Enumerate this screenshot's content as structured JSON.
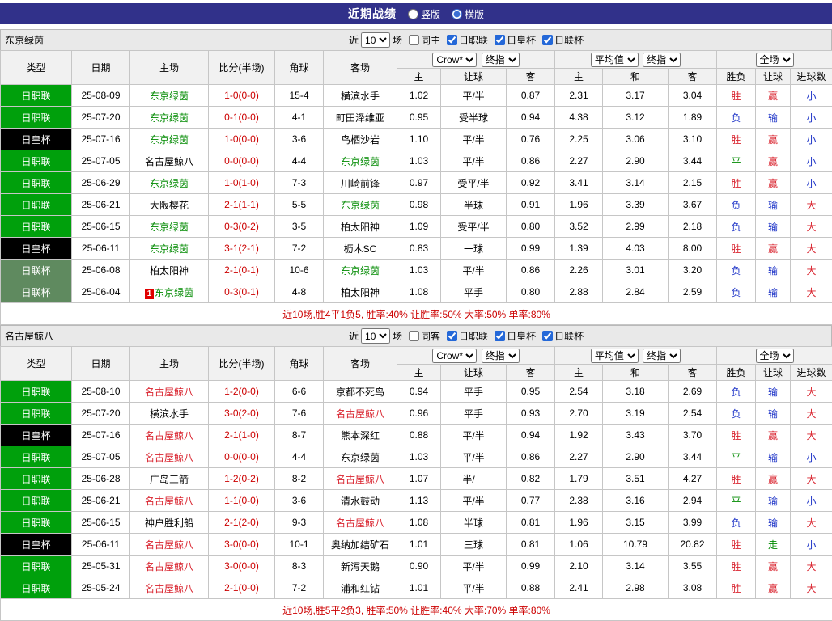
{
  "topbar": {
    "title": "近期战绩",
    "radios": [
      {
        "label": "竖版",
        "selected": false
      },
      {
        "label": "横版",
        "selected": true
      }
    ]
  },
  "filter": {
    "near": "近",
    "count": "10",
    "games": "场"
  },
  "table_header": {
    "cols": [
      "类型",
      "日期",
      "主场",
      "比分(半场)",
      "角球",
      "客场"
    ],
    "book_select": "Crow*",
    "final_select": "终指",
    "avg_select": "平均值",
    "scope_select": "全场",
    "odds_subs": [
      "主",
      "让球",
      "客"
    ],
    "avg_subs": [
      "主",
      "和",
      "客"
    ],
    "result_subs": [
      "胜负",
      "让球",
      "进球数"
    ]
  },
  "sections": [
    {
      "team": "东京绿茵",
      "checkboxes": [
        {
          "label": "同主",
          "checked": false
        },
        {
          "label": "日职联",
          "checked": true
        },
        {
          "label": "日皇杯",
          "checked": true
        },
        {
          "label": "日联杯",
          "checked": true
        }
      ],
      "rows": [
        {
          "league": "日职联",
          "lg": "jl",
          "date": "25-08-09",
          "home": "东京绿茵",
          "hc": "g",
          "badge": "",
          "score": "1-0(0-0)",
          "corner": "15-4",
          "away": "横滨水手",
          "ac": "k",
          "o1": "1.02",
          "hcap": "平/半",
          "o2": "0.87",
          "m1": "2.31",
          "m2": "3.17",
          "m3": "3.04",
          "r1": "胜",
          "r1c": "r",
          "r2": "赢",
          "r2c": "r",
          "r3": "小",
          "r3c": "b"
        },
        {
          "league": "日职联",
          "lg": "jl",
          "date": "25-07-20",
          "home": "东京绿茵",
          "hc": "g",
          "badge": "",
          "score": "0-1(0-0)",
          "corner": "4-1",
          "away": "町田泽维亚",
          "ac": "k",
          "o1": "0.95",
          "hcap": "受半球",
          "o2": "0.94",
          "m1": "4.38",
          "m2": "3.12",
          "m3": "1.89",
          "r1": "负",
          "r1c": "b",
          "r2": "输",
          "r2c": "b",
          "r3": "小",
          "r3c": "b"
        },
        {
          "league": "日皇杯",
          "lg": "hg",
          "date": "25-07-16",
          "home": "东京绿茵",
          "hc": "g",
          "badge": "",
          "score": "1-0(0-0)",
          "corner": "3-6",
          "away": "鸟栖沙岩",
          "ac": "k",
          "o1": "1.10",
          "hcap": "平/半",
          "o2": "0.76",
          "m1": "2.25",
          "m2": "3.06",
          "m3": "3.10",
          "r1": "胜",
          "r1c": "r",
          "r2": "赢",
          "r2c": "r",
          "r3": "小",
          "r3c": "b"
        },
        {
          "league": "日职联",
          "lg": "jl",
          "date": "25-07-05",
          "home": "名古屋鲸八",
          "hc": "k",
          "badge": "",
          "score": "0-0(0-0)",
          "corner": "4-4",
          "away": "东京绿茵",
          "ac": "g",
          "o1": "1.03",
          "hcap": "平/半",
          "o2": "0.86",
          "m1": "2.27",
          "m2": "2.90",
          "m3": "3.44",
          "r1": "平",
          "r1c": "g",
          "r2": "赢",
          "r2c": "r",
          "r3": "小",
          "r3c": "b"
        },
        {
          "league": "日职联",
          "lg": "jl",
          "date": "25-06-29",
          "home": "东京绿茵",
          "hc": "g",
          "badge": "",
          "score": "1-0(1-0)",
          "corner": "7-3",
          "away": "川崎前锋",
          "ac": "k",
          "o1": "0.97",
          "hcap": "受平/半",
          "o2": "0.92",
          "m1": "3.41",
          "m2": "3.14",
          "m3": "2.15",
          "r1": "胜",
          "r1c": "r",
          "r2": "赢",
          "r2c": "r",
          "r3": "小",
          "r3c": "b"
        },
        {
          "league": "日职联",
          "lg": "jl",
          "date": "25-06-21",
          "home": "大阪樱花",
          "hc": "k",
          "badge": "",
          "score": "2-1(1-1)",
          "corner": "5-5",
          "away": "东京绿茵",
          "ac": "g",
          "o1": "0.98",
          "hcap": "半球",
          "o2": "0.91",
          "m1": "1.96",
          "m2": "3.39",
          "m3": "3.67",
          "r1": "负",
          "r1c": "b",
          "r2": "输",
          "r2c": "b",
          "r3": "大",
          "r3c": "r"
        },
        {
          "league": "日职联",
          "lg": "jl",
          "date": "25-06-15",
          "home": "东京绿茵",
          "hc": "g",
          "badge": "",
          "score": "0-3(0-2)",
          "corner": "3-5",
          "away": "柏太阳神",
          "ac": "k",
          "o1": "1.09",
          "hcap": "受平/半",
          "o2": "0.80",
          "m1": "3.52",
          "m2": "2.99",
          "m3": "2.18",
          "r1": "负",
          "r1c": "b",
          "r2": "输",
          "r2c": "b",
          "r3": "大",
          "r3c": "r"
        },
        {
          "league": "日皇杯",
          "lg": "hg",
          "date": "25-06-11",
          "home": "东京绿茵",
          "hc": "g",
          "badge": "",
          "score": "3-1(2-1)",
          "corner": "7-2",
          "away": "枥木SC",
          "ac": "k",
          "o1": "0.83",
          "hcap": "一球",
          "o2": "0.99",
          "m1": "1.39",
          "m2": "4.03",
          "m3": "8.00",
          "r1": "胜",
          "r1c": "r",
          "r2": "赢",
          "r2c": "r",
          "r3": "大",
          "r3c": "r"
        },
        {
          "league": "日联杯",
          "lg": "lb",
          "date": "25-06-08",
          "home": "柏太阳神",
          "hc": "k",
          "badge": "",
          "score": "2-1(0-1)",
          "corner": "10-6",
          "away": "东京绿茵",
          "ac": "g",
          "o1": "1.03",
          "hcap": "平/半",
          "o2": "0.86",
          "m1": "2.26",
          "m2": "3.01",
          "m3": "3.20",
          "r1": "负",
          "r1c": "b",
          "r2": "输",
          "r2c": "b",
          "r3": "大",
          "r3c": "r"
        },
        {
          "league": "日联杯",
          "lg": "lb",
          "date": "25-06-04",
          "home": "东京绿茵",
          "hc": "g",
          "badge": "1",
          "score": "0-3(0-1)",
          "corner": "4-8",
          "away": "柏太阳神",
          "ac": "k",
          "o1": "1.08",
          "hcap": "平手",
          "o2": "0.80",
          "m1": "2.88",
          "m2": "2.84",
          "m3": "2.59",
          "r1": "负",
          "r1c": "b",
          "r2": "输",
          "r2c": "b",
          "r3": "大",
          "r3c": "r"
        }
      ],
      "summary": "近10场,胜4平1负5, 胜率:40% 让胜率:50% 大率:50% 单率:80%"
    },
    {
      "team": "名古屋鲸八",
      "checkboxes": [
        {
          "label": "同客",
          "checked": false
        },
        {
          "label": "日职联",
          "checked": true
        },
        {
          "label": "日皇杯",
          "checked": true
        },
        {
          "label": "日联杯",
          "checked": true
        }
      ],
      "rows": [
        {
          "league": "日职联",
          "lg": "jl",
          "date": "25-08-10",
          "home": "名古屋鲸八",
          "hc": "r",
          "badge": "",
          "score": "1-2(0-0)",
          "corner": "6-6",
          "away": "京都不死鸟",
          "ac": "k",
          "o1": "0.94",
          "hcap": "平手",
          "o2": "0.95",
          "m1": "2.54",
          "m2": "3.18",
          "m3": "2.69",
          "r1": "负",
          "r1c": "b",
          "r2": "输",
          "r2c": "b",
          "r3": "大",
          "r3c": "r"
        },
        {
          "league": "日职联",
          "lg": "jl",
          "date": "25-07-20",
          "home": "横滨水手",
          "hc": "k",
          "badge": "",
          "score": "3-0(2-0)",
          "corner": "7-6",
          "away": "名古屋鲸八",
          "ac": "r",
          "o1": "0.96",
          "hcap": "平手",
          "o2": "0.93",
          "m1": "2.70",
          "m2": "3.19",
          "m3": "2.54",
          "r1": "负",
          "r1c": "b",
          "r2": "输",
          "r2c": "b",
          "r3": "大",
          "r3c": "r"
        },
        {
          "league": "日皇杯",
          "lg": "hg",
          "date": "25-07-16",
          "home": "名古屋鲸八",
          "hc": "r",
          "badge": "",
          "score": "2-1(1-0)",
          "corner": "8-7",
          "away": "熊本深红",
          "ac": "k",
          "o1": "0.88",
          "hcap": "平/半",
          "o2": "0.94",
          "m1": "1.92",
          "m2": "3.43",
          "m3": "3.70",
          "r1": "胜",
          "r1c": "r",
          "r2": "赢",
          "r2c": "r",
          "r3": "大",
          "r3c": "r"
        },
        {
          "league": "日职联",
          "lg": "jl",
          "date": "25-07-05",
          "home": "名古屋鲸八",
          "hc": "r",
          "badge": "",
          "score": "0-0(0-0)",
          "corner": "4-4",
          "away": "东京绿茵",
          "ac": "k",
          "o1": "1.03",
          "hcap": "平/半",
          "o2": "0.86",
          "m1": "2.27",
          "m2": "2.90",
          "m3": "3.44",
          "r1": "平",
          "r1c": "g",
          "r2": "输",
          "r2c": "b",
          "r3": "小",
          "r3c": "b"
        },
        {
          "league": "日职联",
          "lg": "jl",
          "date": "25-06-28",
          "home": "广岛三箭",
          "hc": "k",
          "badge": "",
          "score": "1-2(0-2)",
          "corner": "8-2",
          "away": "名古屋鲸八",
          "ac": "r",
          "o1": "1.07",
          "hcap": "半/一",
          "o2": "0.82",
          "m1": "1.79",
          "m2": "3.51",
          "m3": "4.27",
          "r1": "胜",
          "r1c": "r",
          "r2": "赢",
          "r2c": "r",
          "r3": "大",
          "r3c": "r"
        },
        {
          "league": "日职联",
          "lg": "jl",
          "date": "25-06-21",
          "home": "名古屋鲸八",
          "hc": "r",
          "badge": "",
          "score": "1-1(0-0)",
          "corner": "3-6",
          "away": "清水鼓动",
          "ac": "k",
          "o1": "1.13",
          "hcap": "平/半",
          "o2": "0.77",
          "m1": "2.38",
          "m2": "3.16",
          "m3": "2.94",
          "r1": "平",
          "r1c": "g",
          "r2": "输",
          "r2c": "b",
          "r3": "小",
          "r3c": "b"
        },
        {
          "league": "日职联",
          "lg": "jl",
          "date": "25-06-15",
          "home": "神户胜利船",
          "hc": "k",
          "badge": "",
          "score": "2-1(2-0)",
          "corner": "9-3",
          "away": "名古屋鲸八",
          "ac": "r",
          "o1": "1.08",
          "hcap": "半球",
          "o2": "0.81",
          "m1": "1.96",
          "m2": "3.15",
          "m3": "3.99",
          "r1": "负",
          "r1c": "b",
          "r2": "输",
          "r2c": "b",
          "r3": "大",
          "r3c": "r"
        },
        {
          "league": "日皇杯",
          "lg": "hg",
          "date": "25-06-11",
          "home": "名古屋鲸八",
          "hc": "r",
          "badge": "",
          "score": "3-0(0-0)",
          "corner": "10-1",
          "away": "奥纳加结矿石",
          "ac": "k",
          "o1": "1.01",
          "hcap": "三球",
          "o2": "0.81",
          "m1": "1.06",
          "m2": "10.79",
          "m3": "20.82",
          "r1": "胜",
          "r1c": "r",
          "r2": "走",
          "r2c": "g",
          "r3": "小",
          "r3c": "b"
        },
        {
          "league": "日职联",
          "lg": "jl",
          "date": "25-05-31",
          "home": "名古屋鲸八",
          "hc": "r",
          "badge": "",
          "score": "3-0(0-0)",
          "corner": "8-3",
          "away": "新泻天鹅",
          "ac": "k",
          "o1": "0.90",
          "hcap": "平/半",
          "o2": "0.99",
          "m1": "2.10",
          "m2": "3.14",
          "m3": "3.55",
          "r1": "胜",
          "r1c": "r",
          "r2": "赢",
          "r2c": "r",
          "r3": "大",
          "r3c": "r"
        },
        {
          "league": "日职联",
          "lg": "jl",
          "date": "25-05-24",
          "home": "名古屋鲸八",
          "hc": "r",
          "badge": "",
          "score": "2-1(0-0)",
          "corner": "7-2",
          "away": "浦和红钻",
          "ac": "k",
          "o1": "1.01",
          "hcap": "平/半",
          "o2": "0.88",
          "m1": "2.41",
          "m2": "2.98",
          "m3": "3.08",
          "r1": "胜",
          "r1c": "r",
          "r2": "赢",
          "r2c": "r",
          "r3": "大",
          "r3c": "r"
        }
      ],
      "summary": "近10场,胜5平2负3, 胜率:50% 让胜率:40% 大率:70% 单率:80%"
    }
  ]
}
